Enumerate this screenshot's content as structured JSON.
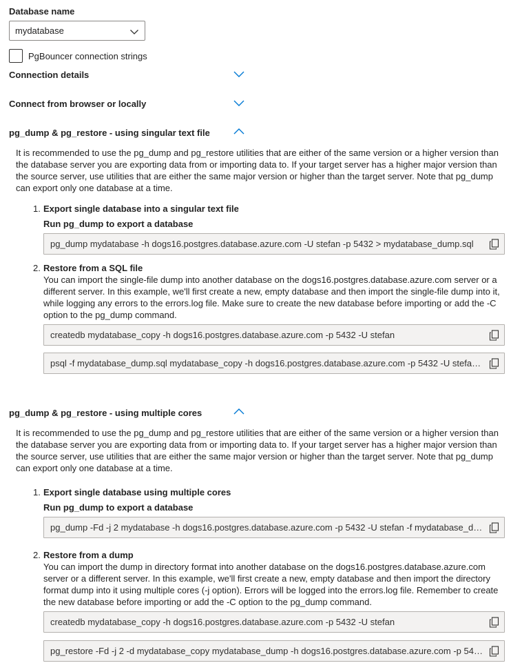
{
  "database": {
    "label": "Database name",
    "selected": "mydatabase"
  },
  "pgbouncer": {
    "label": "PgBouncer connection strings",
    "checked": false
  },
  "sections": {
    "connection_details": {
      "title": "Connection details"
    },
    "connect_browser": {
      "title": "Connect from browser or locally"
    },
    "singular": {
      "title": "pg_dump & pg_restore - using singular text file",
      "intro": "It is recommended to use the pg_dump and pg_restore utilities that are either of the same version or a higher version than the database server you are exporting data from or importing data to. If your target server has a higher major version than the source server, use utilities that are either the same major version or higher than the target server. Note that pg_dump can export only one database at a time.",
      "step1": {
        "number": "1.",
        "title": "Export single database into a singular text file",
        "subtitle": "Run pg_dump to export a database",
        "command": "pg_dump mydatabase -h dogs16.postgres.database.azure.com -U stefan -p 5432 > mydatabase_dump.sql"
      },
      "step2": {
        "number": "2.",
        "title": "Restore from a SQL file",
        "description": "You can import the single-file dump into another database on the dogs16.postgres.database.azure.com server or a different server. In this example, we'll first create a new, empty database and then import the single-file dump into it, while logging any errors to the errors.log file. Make sure to create the new database before importing or add the -C option to the pg_dump command.",
        "command1": "createdb mydatabase_copy -h dogs16.postgres.database.azure.com -p 5432 -U stefan",
        "command2": "psql -f mydatabase_dump.sql mydatabase_copy -h dogs16.postgres.database.azure.com -p 5432 -U stefan ..."
      }
    },
    "multiple": {
      "title": "pg_dump & pg_restore - using multiple cores",
      "intro": "It is recommended to use the pg_dump and pg_restore utilities that are either of the same version or a higher version than the database server you are exporting data from or importing data to. If your target server has a higher major version than the source server, use utilities that are either the same major version or higher than the target server. Note that pg_dump can export only one database at a time.",
      "step1": {
        "number": "1.",
        "title": "Export single database using multiple cores",
        "subtitle": "Run pg_dump to export a database",
        "command": "pg_dump -Fd -j 2 mydatabase -h dogs16.postgres.database.azure.com -p 5432 -U stefan -f mydatabase_du..."
      },
      "step2": {
        "number": "2.",
        "title": "Restore from a dump",
        "description": "You can import the dump in directory format into another database on the dogs16.postgres.database.azure.com server or a different server. In this example, we'll first create a new, empty database and then import the directory format dump into it using multiple cores (-j option). Errors will be logged into the errors.log file. Remember to create the new database before importing or add the -C option to the pg_dump command.",
        "command1": "createdb mydatabase_copy -h dogs16.postgres.database.azure.com -p 5432 -U stefan",
        "command2": "pg_restore -Fd -j 2 -d mydatabase_copy mydatabase_dump -h dogs16.postgres.database.azure.com -p 543..."
      }
    }
  },
  "icons": {
    "dropdown": "chevron-down-icon",
    "collapsed": "chevron-down-icon",
    "expanded": "chevron-up-icon",
    "copy": "copy-icon"
  },
  "colors": {
    "accent": "#0078d4",
    "text": "#242424",
    "code_bg": "#f3f2f1",
    "code_border": "#b3b0ad"
  }
}
